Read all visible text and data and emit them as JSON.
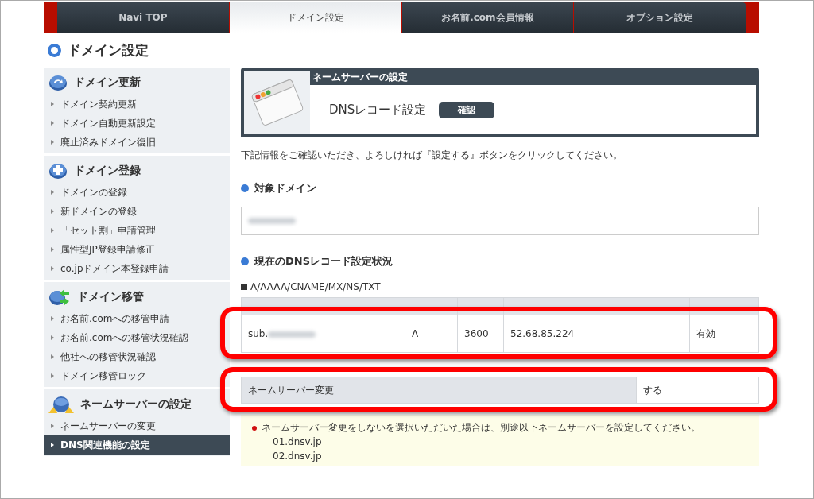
{
  "tabs": [
    {
      "label": "Navi TOP",
      "selected": false
    },
    {
      "label": "ドメイン設定",
      "selected": true
    },
    {
      "label": "お名前.com会員情報",
      "selected": false
    },
    {
      "label": "オプション設定",
      "selected": false
    }
  ],
  "page_title": "ドメイン設定",
  "sidebar": {
    "sections": [
      {
        "title": "ドメイン更新",
        "kind": "refresh",
        "items": [
          {
            "label": "ドメイン契約更新",
            "selected": false
          },
          {
            "label": "ドメイン自動更新設定",
            "selected": false
          },
          {
            "label": "廃止済みドメイン復旧",
            "selected": false
          }
        ]
      },
      {
        "title": "ドメイン登録",
        "kind": "plus",
        "items": [
          {
            "label": "ドメインの登録",
            "selected": false
          },
          {
            "label": "新ドメインの登録",
            "selected": false
          },
          {
            "label": "「セット割」申請管理",
            "selected": false
          },
          {
            "label": "属性型JP登録申請修正",
            "selected": false
          },
          {
            "label": "co.jpドメイン本登録申請",
            "selected": false
          }
        ]
      },
      {
        "title": "ドメイン移管",
        "kind": "transfer",
        "items": [
          {
            "label": "お名前.comへの移管申請",
            "selected": false
          },
          {
            "label": "お名前.comへの移管状況確認",
            "selected": false
          },
          {
            "label": "他社への移管状況確認",
            "selected": false
          },
          {
            "label": "ドメイン移管ロック",
            "selected": false
          }
        ]
      },
      {
        "title": "ネームサーバーの設定",
        "kind": "nameserver",
        "items": [
          {
            "label": "ネームサーバーの変更",
            "selected": false
          },
          {
            "label": "DNS関連機能の設定",
            "selected": true
          }
        ]
      }
    ]
  },
  "card": {
    "label": "ネームサーバーの設定",
    "title": "DNSレコード設定",
    "badge": "確認"
  },
  "instruction": "下記情報をご確認いただき、よろしければ『設定する』ボタンをクリックしてください。",
  "target_domain": {
    "heading": "対象ドメイン"
  },
  "records": {
    "heading": "現在のDNSレコード設定状況",
    "types": "A/AAAA/CNAME/MX/NS/TXT",
    "rows": [
      {
        "host": "sub.",
        "type": "A",
        "ttl": "3600",
        "value": "52.68.85.224",
        "status": "有効"
      }
    ]
  },
  "nameserver_change": {
    "label": "ネームサーバー変更",
    "value": "する"
  },
  "note": {
    "text": "ネームサーバー変更をしないを選択いただいた場合は、別途以下ネームサーバーを設定してください。",
    "servers": [
      "01.dnsv.jp",
      "02.dnsv.jp"
    ]
  }
}
